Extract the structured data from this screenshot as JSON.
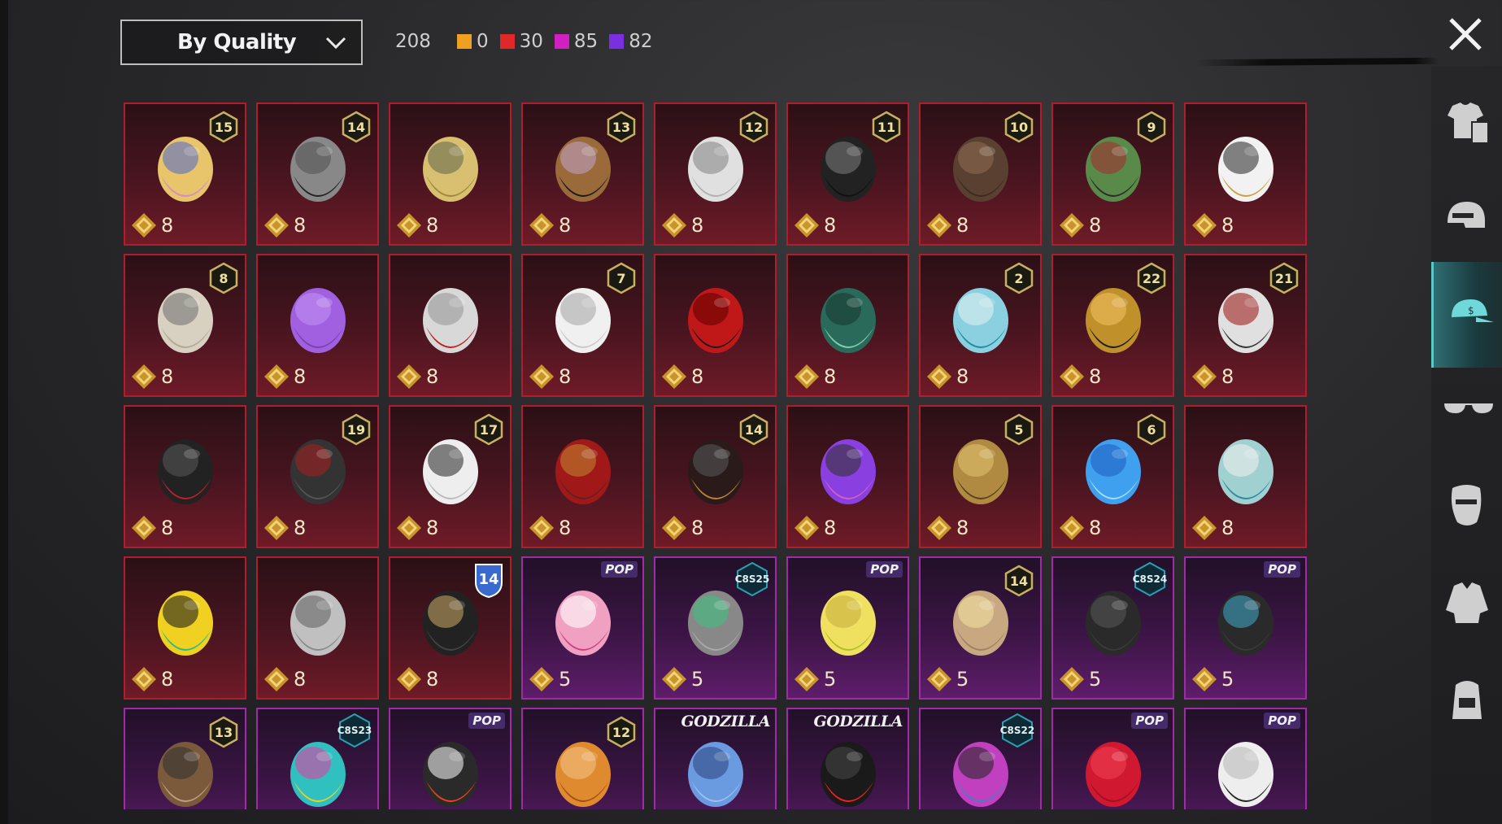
{
  "header": {
    "sort_label": "By Quality",
    "total_count": "208",
    "legend": [
      {
        "color": "#f0a020",
        "count": "0"
      },
      {
        "color": "#e02828",
        "count": "30"
      },
      {
        "color": "#d020c0",
        "count": "85"
      },
      {
        "color": "#7a30e0",
        "count": "82"
      }
    ]
  },
  "items": [
    {
      "name": "hair-blonde-pink-icon",
      "level": "15",
      "price": "8",
      "rarity": "red"
    },
    {
      "name": "cat-mask-helmet-icon",
      "level": "14",
      "price": "8",
      "rarity": "red"
    },
    {
      "name": "blonde-hair-goggles-icon",
      "level": "",
      "price": "8",
      "rarity": "red"
    },
    {
      "name": "pirate-hat-hair-icon",
      "level": "13",
      "price": "8",
      "rarity": "red"
    },
    {
      "name": "white-hair-bow-icon",
      "level": "12",
      "price": "8",
      "rarity": "red"
    },
    {
      "name": "black-hair-streak-icon",
      "level": "11",
      "price": "8",
      "rarity": "red"
    },
    {
      "name": "long-brown-hair-icon",
      "level": "10",
      "price": "8",
      "rarity": "red"
    },
    {
      "name": "zombie-head-icon",
      "level": "9",
      "price": "8",
      "rarity": "red"
    },
    {
      "name": "white-cowboy-hat-icon",
      "level": "",
      "price": "8",
      "rarity": "red"
    },
    {
      "name": "silver-hair-wing-icon",
      "level": "8",
      "price": "8",
      "rarity": "red"
    },
    {
      "name": "purple-hair-ribbon-icon",
      "level": "",
      "price": "8",
      "rarity": "red"
    },
    {
      "name": "red-oni-mask-icon",
      "level": "",
      "price": "8",
      "rarity": "red"
    },
    {
      "name": "white-long-hair-icon",
      "level": "7",
      "price": "8",
      "rarity": "red"
    },
    {
      "name": "red-black-helmet-icon",
      "level": "",
      "price": "8",
      "rarity": "red"
    },
    {
      "name": "jade-dragon-helmet-icon",
      "level": "",
      "price": "8",
      "rarity": "red"
    },
    {
      "name": "cyan-bucket-hat-icon",
      "level": "2",
      "price": "8",
      "rarity": "red"
    },
    {
      "name": "pharaoh-headdress-icon",
      "level": "22",
      "price": "8",
      "rarity": "red"
    },
    {
      "name": "joker-mask-icon",
      "level": "21",
      "price": "8",
      "rarity": "red"
    },
    {
      "name": "red-demon-helmet-icon",
      "level": "",
      "price": "8",
      "rarity": "red"
    },
    {
      "name": "dark-knight-helmet-icon",
      "level": "19",
      "price": "8",
      "rarity": "red"
    },
    {
      "name": "white-ponytail-icon",
      "level": "17",
      "price": "8",
      "rarity": "red"
    },
    {
      "name": "red-visor-helmet-icon",
      "level": "",
      "price": "8",
      "rarity": "red"
    },
    {
      "name": "dark-samurai-helmet-icon",
      "level": "14",
      "price": "8",
      "rarity": "red"
    },
    {
      "name": "purple-feather-mask-icon",
      "level": "",
      "price": "8",
      "rarity": "red"
    },
    {
      "name": "gold-armor-helmet-icon",
      "level": "5",
      "price": "8",
      "rarity": "red"
    },
    {
      "name": "ice-crystal-helmet-icon",
      "level": "6",
      "price": "8",
      "rarity": "red"
    },
    {
      "name": "white-cyan-mask-icon",
      "level": "",
      "price": "8",
      "rarity": "red"
    },
    {
      "name": "gold-green-helmet-icon",
      "level": "",
      "price": "8",
      "rarity": "red"
    },
    {
      "name": "straw-cone-hat-icon",
      "level": "",
      "price": "8",
      "rarity": "red"
    },
    {
      "name": "officer-cap-icon",
      "level": "",
      "price": "8",
      "rarity": "red",
      "shield": "14"
    },
    {
      "name": "pink-bow-headband-icon",
      "badge": "POP",
      "price": "5",
      "rarity": "purple"
    },
    {
      "name": "grey-hair-bun-icon",
      "badge": "C8S25",
      "price": "5",
      "rarity": "purple"
    },
    {
      "name": "yellow-box-head-icon",
      "badge": "POP",
      "price": "5",
      "rarity": "purple"
    },
    {
      "name": "wavy-blonde-hair-icon",
      "level": "14",
      "price": "5",
      "rarity": "purple"
    },
    {
      "name": "dark-bob-hair-icon",
      "badge": "C8S24",
      "price": "5",
      "rarity": "purple"
    },
    {
      "name": "dark-hair-ribbon-icon",
      "badge": "POP",
      "price": "5",
      "rarity": "purple"
    },
    {
      "name": "aviator-goggles-cap-icon",
      "level": "13",
      "price": "",
      "rarity": "purple"
    },
    {
      "name": "cat-ear-headphones-icon",
      "badge": "C8S23",
      "price": "",
      "rarity": "purple"
    },
    {
      "name": "black-cap-shades-icon",
      "badge": "POP",
      "price": "",
      "rarity": "purple"
    },
    {
      "name": "orange-pigtails-icon",
      "level": "12",
      "price": "",
      "rarity": "purple"
    },
    {
      "name": "blue-godzilla-hair-icon",
      "badge": "GODZILLA",
      "price": "",
      "rarity": "purple"
    },
    {
      "name": "spiky-hair-glasses-icon",
      "badge": "GODZILLA",
      "price": "",
      "rarity": "purple"
    },
    {
      "name": "magenta-blue-hair-icon",
      "badge": "C8S22",
      "price": "",
      "rarity": "purple"
    },
    {
      "name": "red-hair-icon",
      "badge": "POP",
      "price": "",
      "rarity": "purple"
    },
    {
      "name": "panda-head-icon",
      "badge": "POP",
      "price": "",
      "rarity": "purple"
    }
  ],
  "sidebar": [
    {
      "name": "outfit-category-icon",
      "active": false
    },
    {
      "name": "helmet-category-icon",
      "active": false
    },
    {
      "name": "cap-category-icon",
      "active": true
    },
    {
      "name": "glasses-category-icon",
      "active": false
    },
    {
      "name": "mask-category-icon",
      "active": false
    },
    {
      "name": "jacket-category-icon",
      "active": false
    },
    {
      "name": "backpack-category-icon",
      "active": false
    }
  ]
}
